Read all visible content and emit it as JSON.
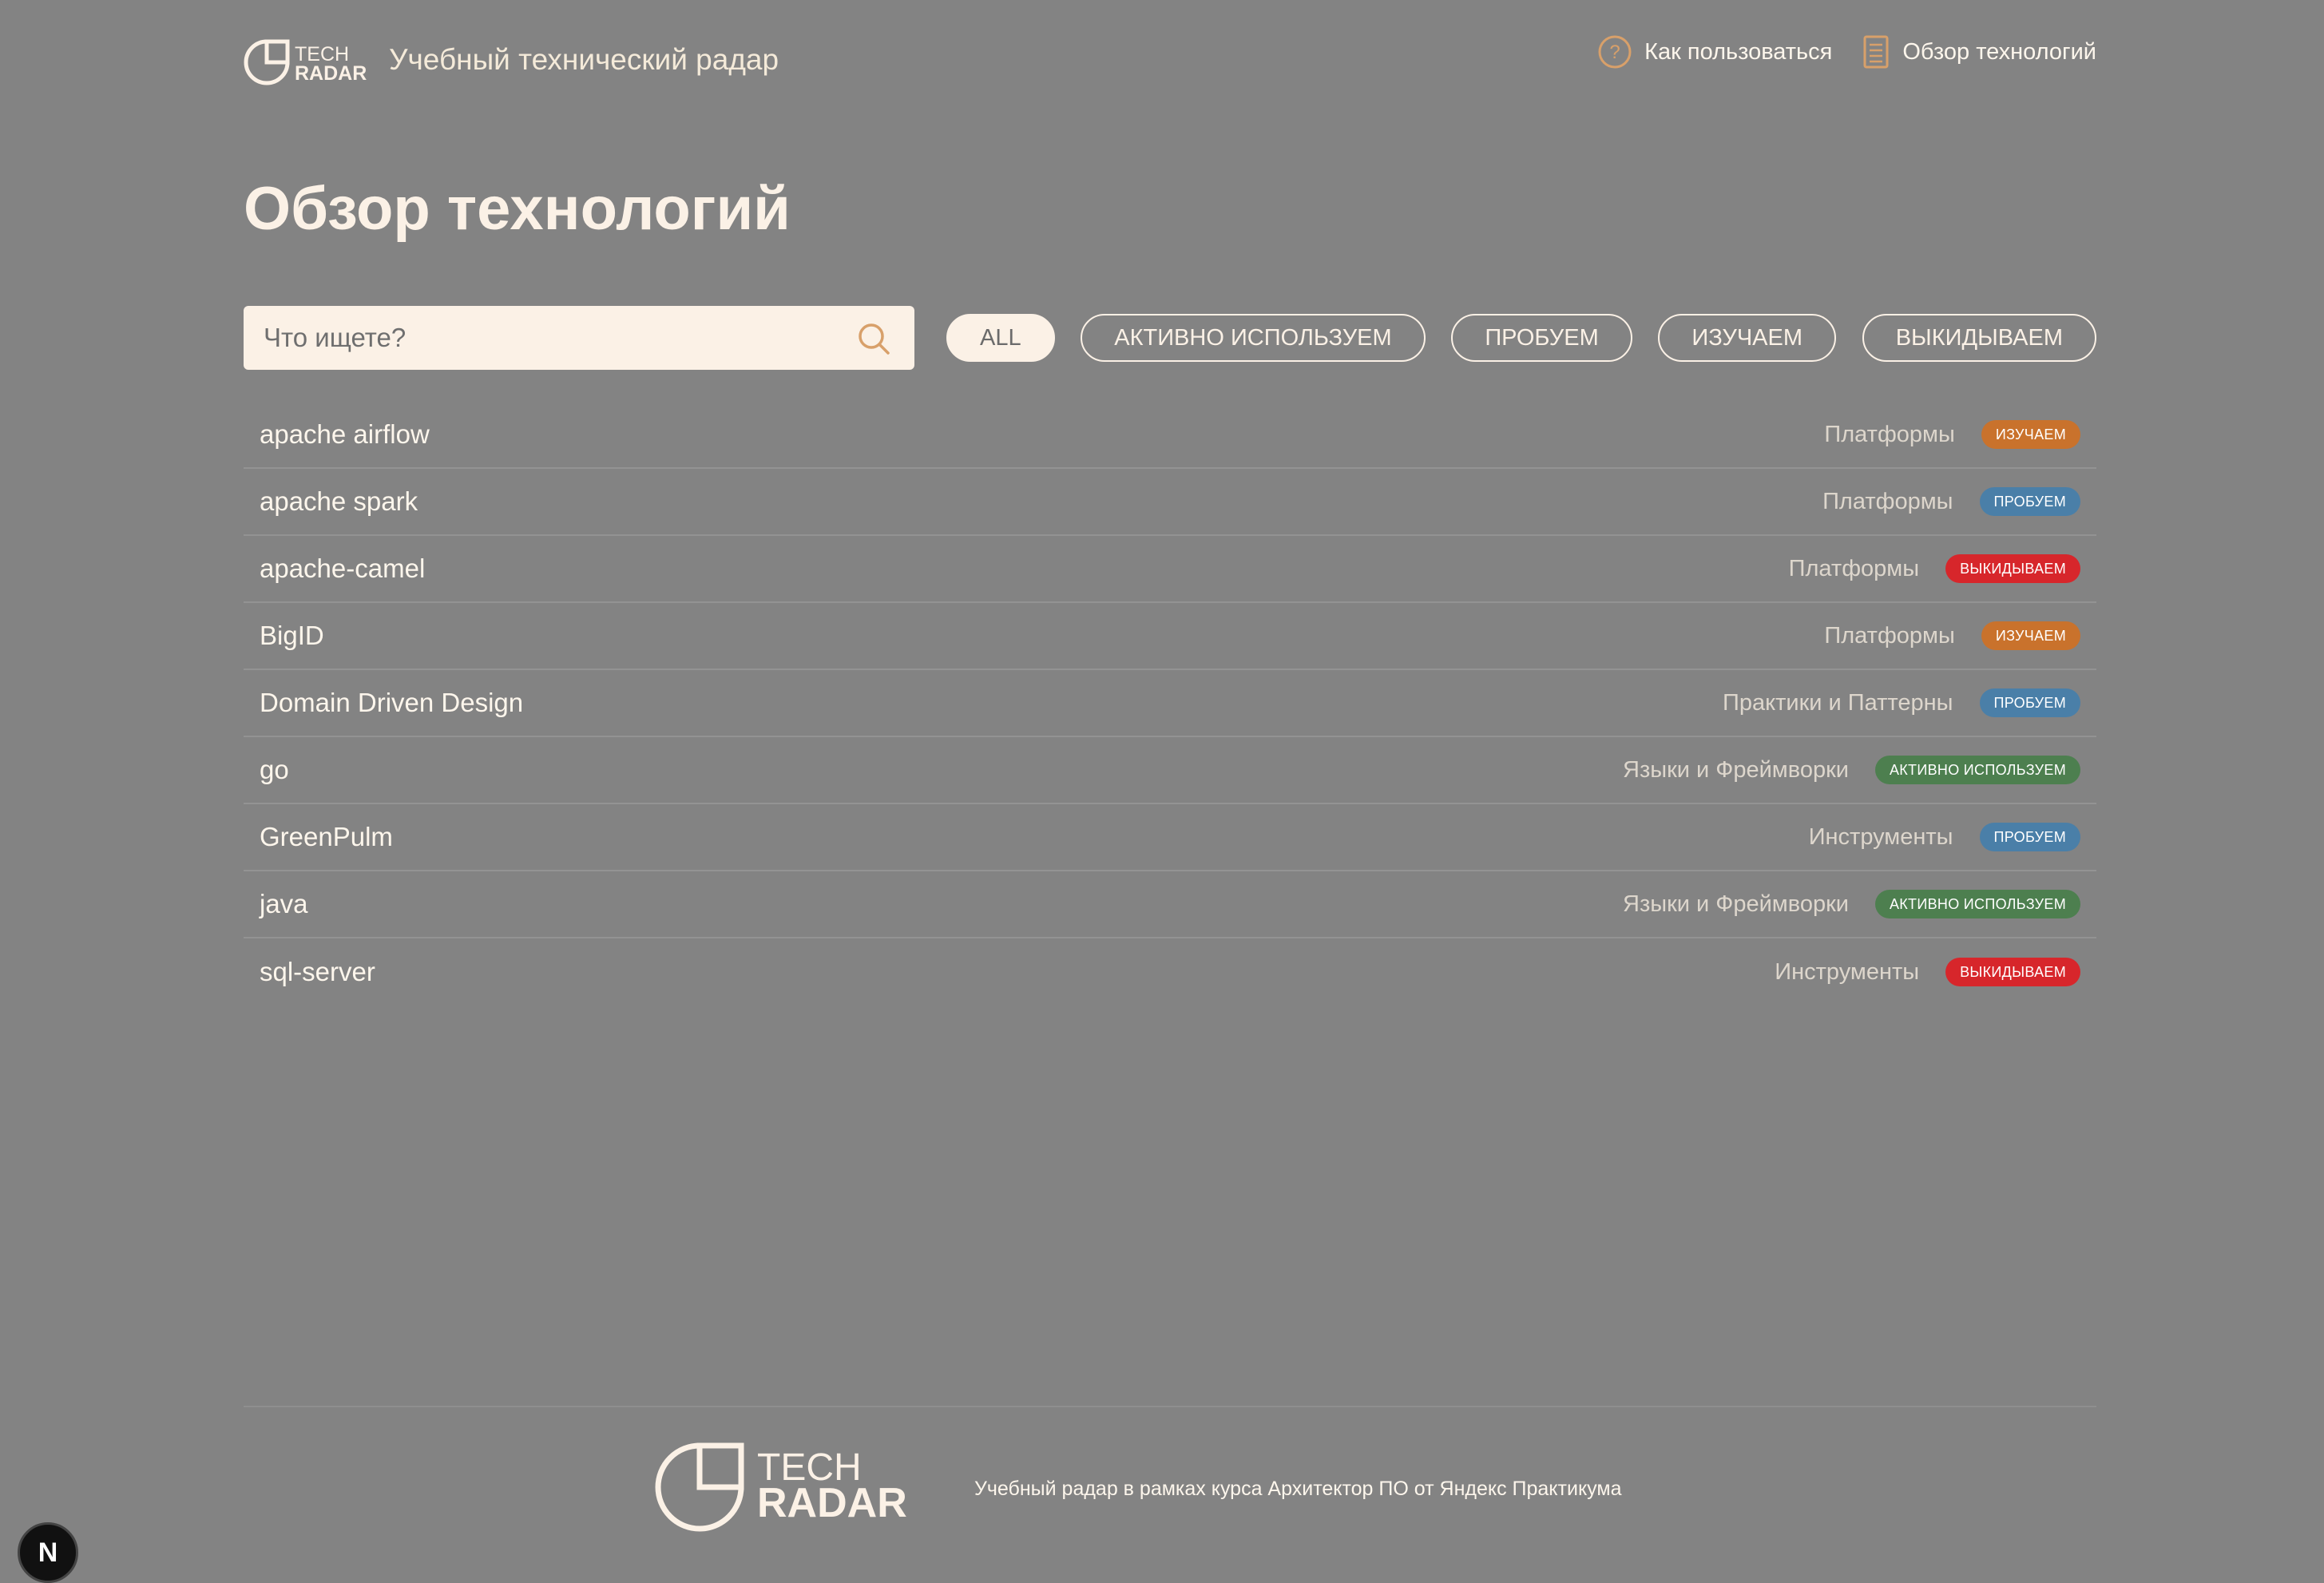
{
  "header": {
    "logo_tech": "TECH",
    "logo_radar": "RADAR",
    "site_title": "Учебный технический радар",
    "nav": [
      {
        "label": "Как пользоваться",
        "icon": "question-circle-icon"
      },
      {
        "label": "Обзор технологий",
        "icon": "document-list-icon"
      }
    ]
  },
  "page_title": "Обзор технологий",
  "search": {
    "placeholder": "Что ищете?",
    "value": "",
    "icon": "search-icon"
  },
  "filters": [
    {
      "label": "ALL",
      "active": true
    },
    {
      "label": "АКТИВНО ИСПОЛЬЗУЕМ",
      "active": false
    },
    {
      "label": "ПРОБУЕМ",
      "active": false
    },
    {
      "label": "ИЗУЧАЕМ",
      "active": false
    },
    {
      "label": "ВЫКИДЫВАЕМ",
      "active": false
    }
  ],
  "status_colors": {
    "ИЗУЧАЕМ": "#c9722c",
    "ПРОБУЕМ": "#4a7fa8",
    "ВЫКИДЫВАЕМ": "#d7262b",
    "АКТИВНО ИСПОЛЬЗУЕМ": "#4d7f4f"
  },
  "technologies": [
    {
      "name": "apache airflow",
      "category": "Платформы",
      "status": "ИЗУЧАЕМ"
    },
    {
      "name": "apache spark",
      "category": "Платформы",
      "status": "ПРОБУЕМ"
    },
    {
      "name": "apache-camel",
      "category": "Платформы",
      "status": "ВЫКИДЫВАЕМ"
    },
    {
      "name": "BigID",
      "category": "Платформы",
      "status": "ИЗУЧАЕМ"
    },
    {
      "name": "Domain Driven Design",
      "category": "Практики и Паттерны",
      "status": "ПРОБУЕМ"
    },
    {
      "name": "go",
      "category": "Языки и Фреймворки",
      "status": "АКТИВНО ИСПОЛЬЗУЕМ"
    },
    {
      "name": "GreenPulm",
      "category": "Инструменты",
      "status": "ПРОБУЕМ"
    },
    {
      "name": "java",
      "category": "Языки и Фреймворки",
      "status": "АКТИВНО ИСПОЛЬЗУЕМ"
    },
    {
      "name": "sql-server",
      "category": "Инструменты",
      "status": "ВЫКИДЫВАЕМ"
    }
  ],
  "footer": {
    "logo_tech": "TECH",
    "logo_radar": "RADAR",
    "text": "Учебный радар в рамках курса Архитектор ПО от Яндекс Практикума"
  },
  "next_badge": "N",
  "colors": {
    "background": "#838383",
    "cream": "#fbf1e6",
    "accent_orange": "#d8a06a"
  }
}
